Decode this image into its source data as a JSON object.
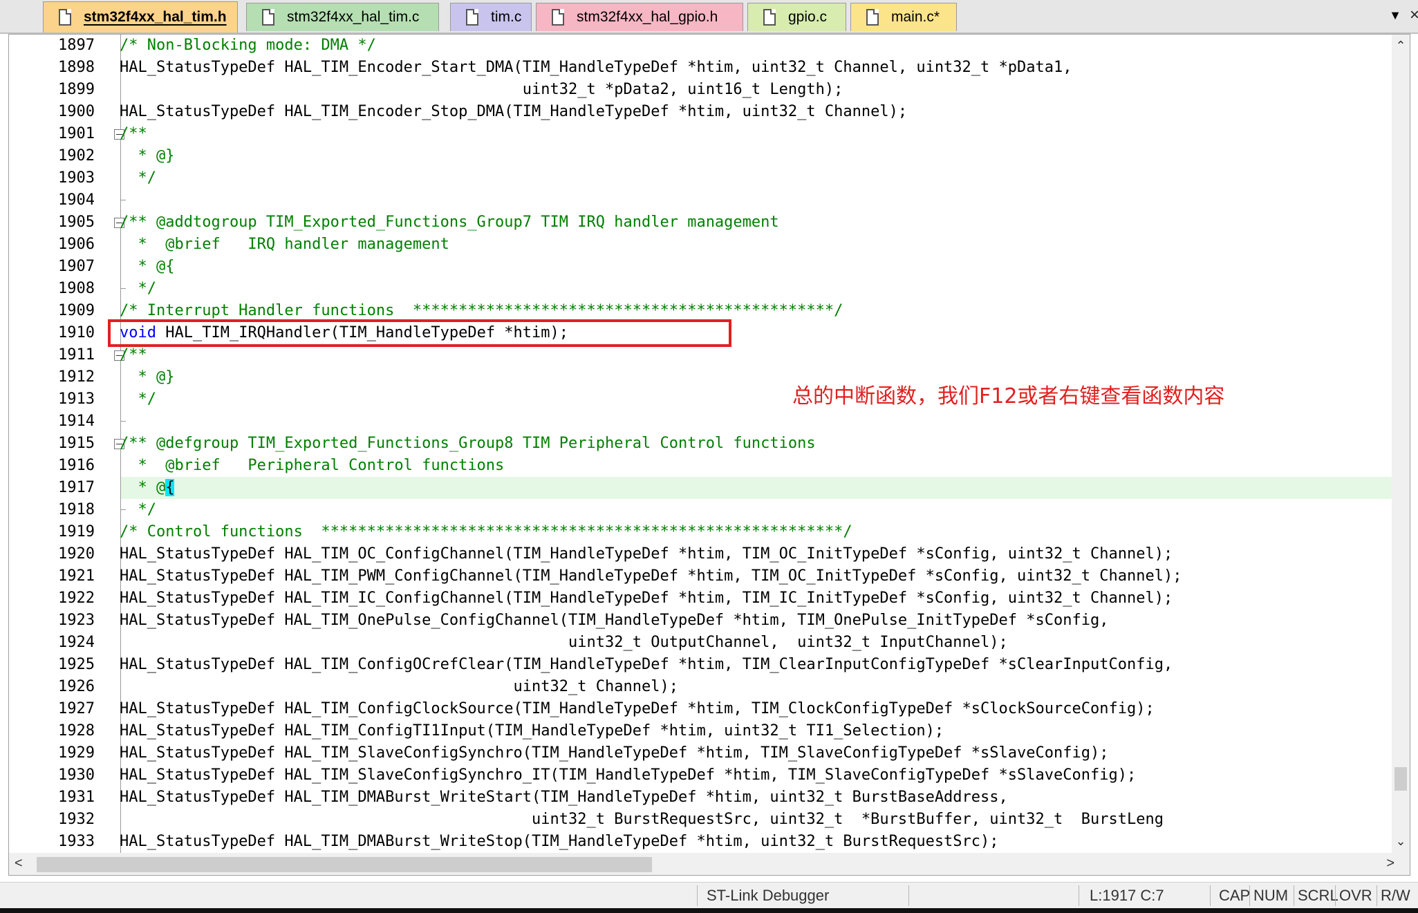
{
  "tabs": [
    {
      "label": "stm32f4xx_hal_tim.h",
      "color": "#fbd38a",
      "active": true
    },
    {
      "label": "stm32f4xx_hal_tim.c",
      "color": "#b5dfb2",
      "active": false
    },
    {
      "label": "tim.c",
      "color": "#c9c4ee",
      "active": false
    },
    {
      "label": "stm32f4xx_hal_gpio.h",
      "color": "#f6b6c3",
      "active": false
    },
    {
      "label": "gpio.c",
      "color": "#d7ecae",
      "active": false
    },
    {
      "label": "main.c*",
      "color": "#fbe48a",
      "active": false
    }
  ],
  "tab_menu_icon": "▼",
  "close_icon": "×",
  "lines": [
    {
      "n": "1897",
      "text": "/* Non-Blocking mode: DMA */",
      "type": "comment"
    },
    {
      "n": "1898",
      "text": "HAL_StatusTypeDef HAL_TIM_Encoder_Start_DMA(TIM_HandleTypeDef *htim, uint32_t Channel, uint32_t *pData1,",
      "type": "code"
    },
    {
      "n": "1899",
      "text": "                                            uint32_t *pData2, uint16_t Length);",
      "type": "code"
    },
    {
      "n": "1900",
      "text": "HAL_StatusTypeDef HAL_TIM_Encoder_Stop_DMA(TIM_HandleTypeDef *htim, uint32_t Channel);",
      "type": "code"
    },
    {
      "n": "1901",
      "text": "/**",
      "type": "comment",
      "fold": true
    },
    {
      "n": "1902",
      "text": "  * @}",
      "type": "comment"
    },
    {
      "n": "1903",
      "text": "  */",
      "type": "comment"
    },
    {
      "n": "1904",
      "text": "",
      "type": "code",
      "tick": true
    },
    {
      "n": "1905",
      "text": "/** @addtogroup TIM_Exported_Functions_Group7 TIM IRQ handler management",
      "type": "comment",
      "fold": true
    },
    {
      "n": "1906",
      "text": "  *  @brief   IRQ handler management",
      "type": "comment"
    },
    {
      "n": "1907",
      "text": "  * @{",
      "type": "comment"
    },
    {
      "n": "1908",
      "text": "  */",
      "type": "comment",
      "tick": true
    },
    {
      "n": "1909",
      "text": "/* Interrupt Handler functions  **********************************************/",
      "type": "comment"
    },
    {
      "n": "1910",
      "text": "HAL_TIM_IRQHandler(TIM_HandleTypeDef *htim);",
      "type": "code",
      "keyword": "void"
    },
    {
      "n": "1911",
      "text": "/**",
      "type": "comment",
      "fold": true
    },
    {
      "n": "1912",
      "text": "  * @}",
      "type": "comment"
    },
    {
      "n": "1913",
      "text": "  */",
      "type": "comment"
    },
    {
      "n": "1914",
      "text": "",
      "type": "code",
      "tick": true
    },
    {
      "n": "1915",
      "text": "/** @defgroup TIM_Exported_Functions_Group8 TIM Peripheral Control functions",
      "type": "comment",
      "fold": true
    },
    {
      "n": "1916",
      "text": "  *  @brief   Peripheral Control functions",
      "type": "comment"
    },
    {
      "n": "1917",
      "text": "  * @",
      "type": "comment",
      "current": true,
      "brace": "{"
    },
    {
      "n": "1918",
      "text": "  */",
      "type": "comment",
      "tick": true
    },
    {
      "n": "1919",
      "text": "/* Control functions  *********************************************************/",
      "type": "comment"
    },
    {
      "n": "1920",
      "text": "HAL_StatusTypeDef HAL_TIM_OC_ConfigChannel(TIM_HandleTypeDef *htim, TIM_OC_InitTypeDef *sConfig, uint32_t Channel);",
      "type": "code"
    },
    {
      "n": "1921",
      "text": "HAL_StatusTypeDef HAL_TIM_PWM_ConfigChannel(TIM_HandleTypeDef *htim, TIM_OC_InitTypeDef *sConfig, uint32_t Channel);",
      "type": "code"
    },
    {
      "n": "1922",
      "text": "HAL_StatusTypeDef HAL_TIM_IC_ConfigChannel(TIM_HandleTypeDef *htim, TIM_IC_InitTypeDef *sConfig, uint32_t Channel);",
      "type": "code"
    },
    {
      "n": "1923",
      "text": "HAL_StatusTypeDef HAL_TIM_OnePulse_ConfigChannel(TIM_HandleTypeDef *htim, TIM_OnePulse_InitTypeDef *sConfig,",
      "type": "code"
    },
    {
      "n": "1924",
      "text": "                                                 uint32_t OutputChannel,  uint32_t InputChannel);",
      "type": "code"
    },
    {
      "n": "1925",
      "text": "HAL_StatusTypeDef HAL_TIM_ConfigOCrefClear(TIM_HandleTypeDef *htim, TIM_ClearInputConfigTypeDef *sClearInputConfig,",
      "type": "code"
    },
    {
      "n": "1926",
      "text": "                                           uint32_t Channel);",
      "type": "code"
    },
    {
      "n": "1927",
      "text": "HAL_StatusTypeDef HAL_TIM_ConfigClockSource(TIM_HandleTypeDef *htim, TIM_ClockConfigTypeDef *sClockSourceConfig);",
      "type": "code"
    },
    {
      "n": "1928",
      "text": "HAL_StatusTypeDef HAL_TIM_ConfigTI1Input(TIM_HandleTypeDef *htim, uint32_t TI1_Selection);",
      "type": "code"
    },
    {
      "n": "1929",
      "text": "HAL_StatusTypeDef HAL_TIM_SlaveConfigSynchro(TIM_HandleTypeDef *htim, TIM_SlaveConfigTypeDef *sSlaveConfig);",
      "type": "code"
    },
    {
      "n": "1930",
      "text": "HAL_StatusTypeDef HAL_TIM_SlaveConfigSynchro_IT(TIM_HandleTypeDef *htim, TIM_SlaveConfigTypeDef *sSlaveConfig);",
      "type": "code"
    },
    {
      "n": "1931",
      "text": "HAL_StatusTypeDef HAL_TIM_DMABurst_WriteStart(TIM_HandleTypeDef *htim, uint32_t BurstBaseAddress,",
      "type": "code"
    },
    {
      "n": "1932",
      "text": "                                             uint32_t BurstRequestSrc, uint32_t  *BurstBuffer, uint32_t  BurstLeng",
      "type": "code"
    },
    {
      "n": "1933",
      "text": "HAL_StatusTypeDef HAL_TIM_DMABurst_WriteStop(TIM_HandleTypeDef *htim, uint32_t BurstRequestSrc);",
      "type": "code"
    }
  ],
  "annotation": "总的中断函数，我们F12或者右键查看函数内容",
  "annotation_color": "#e02020",
  "statusbar": {
    "debugger": "ST-Link Debugger",
    "position": "L:1917 C:7",
    "cap": "CAP",
    "num": "NUM",
    "scrl": "SCRL",
    "ovr": "OVR",
    "rw": "R/W"
  },
  "scroll": {
    "up": "⌃",
    "down": "⌄",
    "left": "<",
    "right": ">"
  }
}
